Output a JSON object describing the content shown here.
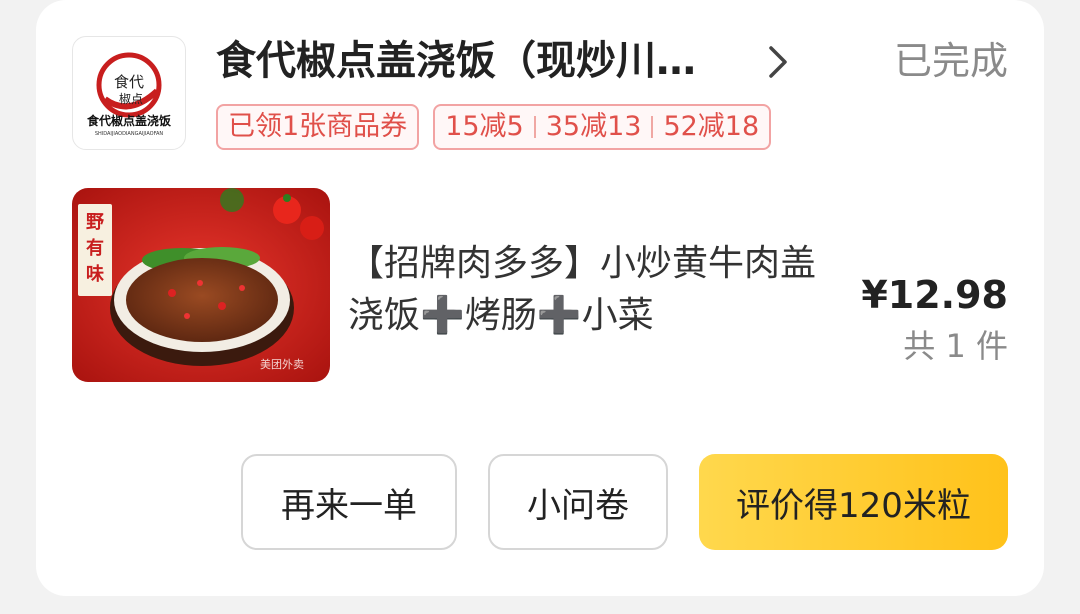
{
  "store": {
    "name": "食代椒点盖浇饭（现炒川…",
    "logo_text": "食代椒点盖浇饭",
    "logo_subtext": "SHIDAIJIAODIANGAIJIAOFAN",
    "logo_brush_text": "食代椒点",
    "status": "已完成",
    "icons": {
      "logo": "store-logo",
      "arrow": "chevron-right-icon"
    }
  },
  "coupons": {
    "received": "已领1张商品券",
    "discounts": [
      "15减5",
      "35减13",
      "52减18"
    ]
  },
  "product": {
    "title": "【招牌肉多多】小炒黄牛肉盖浇饭➕烤肠➕小菜",
    "price": "¥12.98",
    "quantity": "共 1 件",
    "image_badge": "野有味",
    "image_watermark": "美团外卖"
  },
  "actions": {
    "reorder": "再来一单",
    "survey": "小问卷",
    "review": "评价得120米粒"
  },
  "colors": {
    "accent_yellow": "#ffc21a",
    "coupon_red": "#e0504a",
    "status_gray": "#8a8a8a"
  }
}
